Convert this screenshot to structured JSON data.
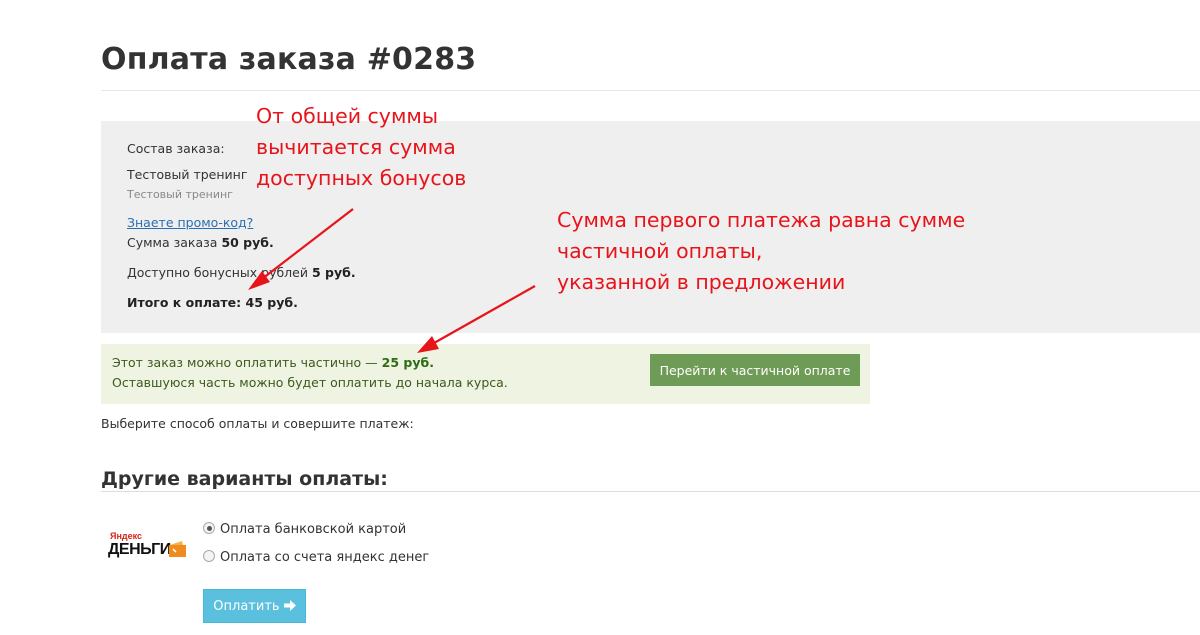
{
  "page": {
    "title": "Оплата заказа #0283"
  },
  "order": {
    "composition_label": "Состав заказа:",
    "item_title": "Тестовый тренинг",
    "item_subtitle": "Тестовый тренинг",
    "promo_link": "Знаете промо-код?",
    "sum_label": "Сумма заказа",
    "sum_value": "50 руб.",
    "bonus_label": "Доступно бонусных рублей",
    "bonus_value": "5 руб.",
    "total_label": "Итого к оплате:",
    "total_value": "45 руб."
  },
  "partial": {
    "text_prefix": "Этот заказ можно оплатить частично —",
    "amount": "25 руб.",
    "text_line2": "Оставшуюся часть можно будет оплатить до начала курса.",
    "button_label": "Перейти к частичной оплате"
  },
  "payment": {
    "instruction": "Выберите способ оплаты и совершите платеж:",
    "other_title": "Другие варианты оплаты:",
    "logo_top": "Яндекс",
    "logo_bottom": "ДЕНЬГИ",
    "options": [
      {
        "label": "Оплата банковской картой",
        "selected": true
      },
      {
        "label": "Оплата со счета яндекс денег",
        "selected": false
      }
    ],
    "pay_button": "Оплатить",
    "pay_icon": "arrow-right-icon"
  },
  "annotations": {
    "note1": [
      "От общей суммы",
      "вычитается сумма",
      "доступных бонусов"
    ],
    "note2": [
      "Сумма первого платежа равна сумме",
      "частичной оплаты,",
      "указанной в предложении"
    ]
  },
  "colors": {
    "annotation": "#e8141b",
    "partial_button": "#6e9b55",
    "pay_button": "#5bc0de",
    "logo_accent": "#f08c1e"
  }
}
